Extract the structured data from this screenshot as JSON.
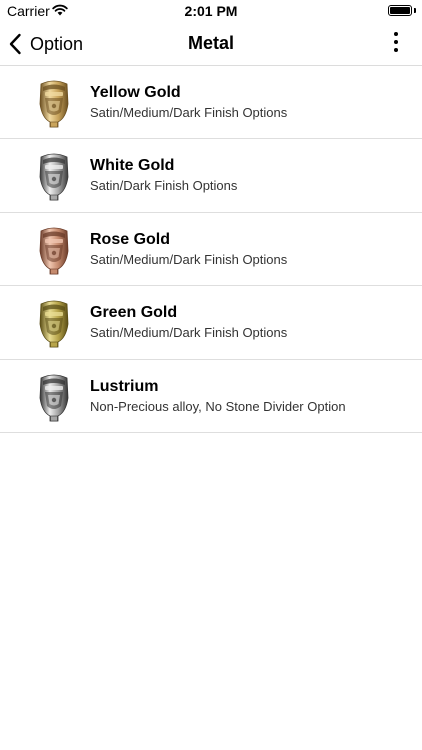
{
  "status_bar": {
    "carrier": "Carrier",
    "time": "2:01 PM"
  },
  "nav": {
    "back_label": "Option",
    "title": "Metal"
  },
  "metals": [
    {
      "title": "Yellow Gold",
      "subtitle": "Satin/Medium/Dark Finish Options",
      "colors": {
        "base": "#c9a45c",
        "light": "#f0d9a0",
        "dark": "#6b4f20"
      }
    },
    {
      "title": "White Gold",
      "subtitle": "Satin/Dark Finish Options",
      "colors": {
        "base": "#a9a9a9",
        "light": "#eeeeee",
        "dark": "#3a3a3a"
      }
    },
    {
      "title": "Rose Gold",
      "subtitle": "Satin/Medium/Dark Finish Options",
      "colors": {
        "base": "#c58a6e",
        "light": "#f0c6b0",
        "dark": "#6a3b28"
      }
    },
    {
      "title": "Green Gold",
      "subtitle": "Satin/Medium/Dark Finish Options",
      "colors": {
        "base": "#b7a44a",
        "light": "#e8dc92",
        "dark": "#5a4d15"
      }
    },
    {
      "title": "Lustrium",
      "subtitle": "Non-Precious alloy, No Stone Divider Option",
      "colors": {
        "base": "#a4a4a4",
        "light": "#ececec",
        "dark": "#343434"
      }
    }
  ]
}
